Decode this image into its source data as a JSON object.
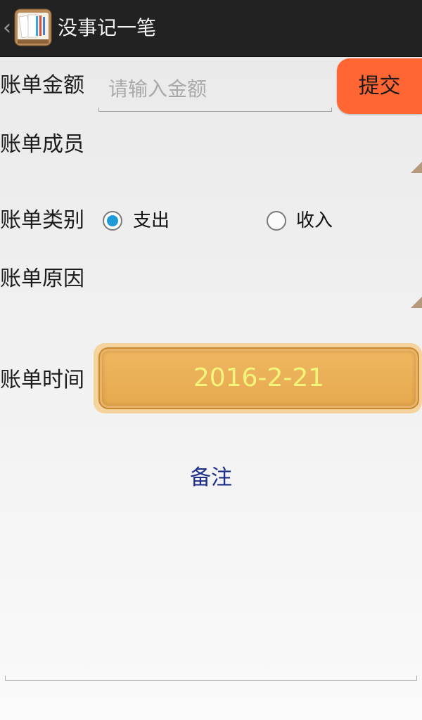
{
  "actionbar": {
    "back_glyph": "‹",
    "app_icon": "notebook-app-icon",
    "title": "没事记一笔"
  },
  "amount": {
    "label": "账单金额",
    "placeholder": "请输入金额",
    "value": ""
  },
  "submit": {
    "label": "提交",
    "color": "#ff6633"
  },
  "member": {
    "label": "账单成员",
    "selected": ""
  },
  "category": {
    "label": "账单类别",
    "options": [
      {
        "label": "支出",
        "checked": true
      },
      {
        "label": "收入",
        "checked": false
      }
    ],
    "accent": "#1e9bd7"
  },
  "reason": {
    "label": "账单原因",
    "selected": ""
  },
  "time": {
    "label": "账单时间",
    "date": "2016-2-21",
    "button_color": "#e8ad55",
    "text_color": "#f2f57a"
  },
  "note": {
    "label": "备注",
    "value": ""
  }
}
